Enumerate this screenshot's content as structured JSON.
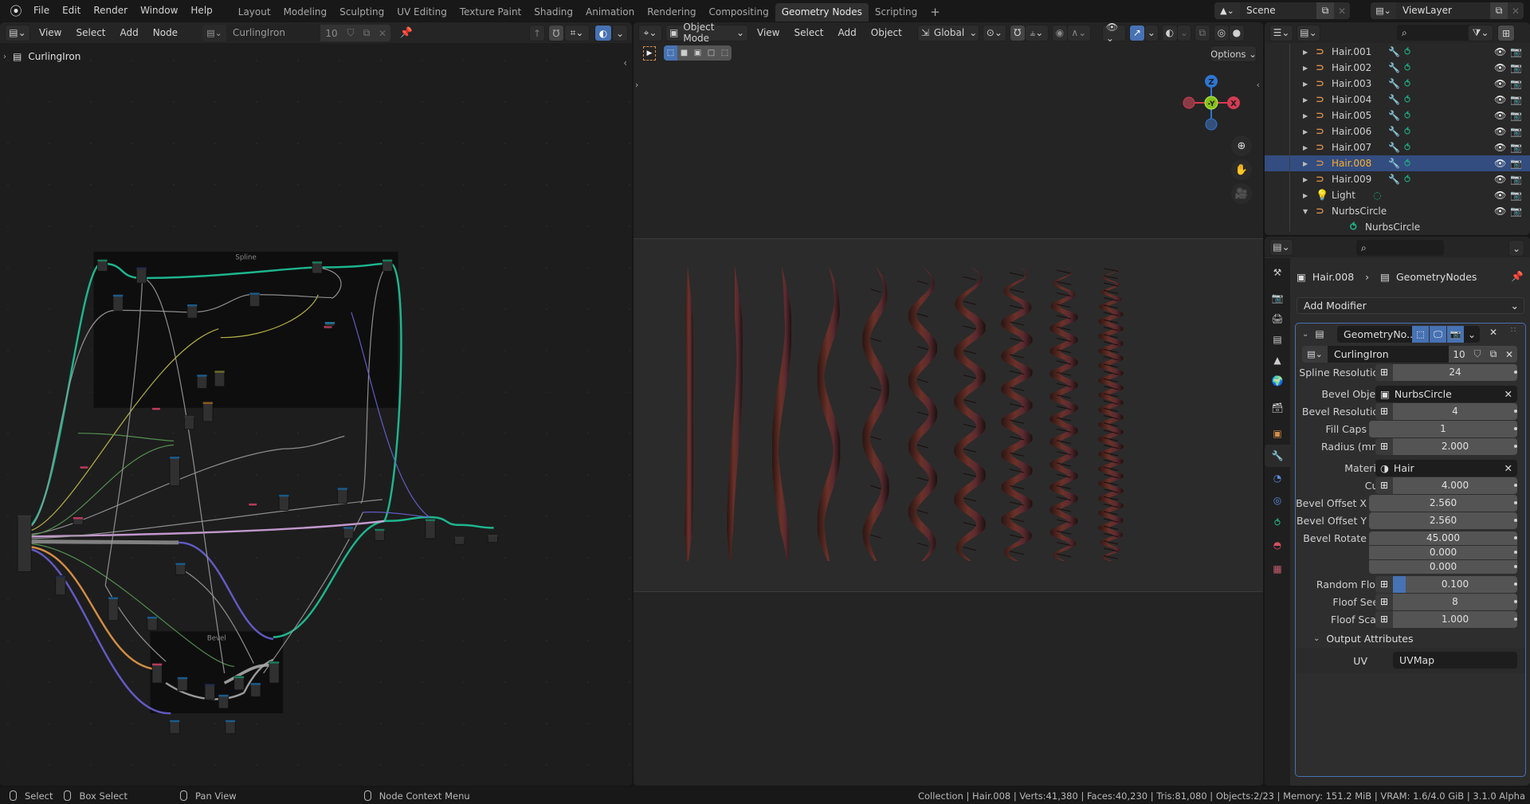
{
  "topbar": {
    "menus": [
      "File",
      "Edit",
      "Render",
      "Window",
      "Help"
    ],
    "workspaces": [
      "Layout",
      "Modeling",
      "Sculpting",
      "UV Editing",
      "Texture Paint",
      "Shading",
      "Animation",
      "Rendering",
      "Compositing",
      "Geometry Nodes",
      "Scripting"
    ],
    "active_workspace": "Geometry Nodes",
    "add_workspace": "+",
    "scene": "Scene",
    "view_layer": "ViewLayer"
  },
  "node_editor": {
    "menus": [
      "View",
      "Select",
      "Add",
      "Node"
    ],
    "node_group": "CurlingIron",
    "users": "10",
    "breadcrumb": "CurlingIron",
    "frames": [
      {
        "label": "Spline"
      },
      {
        "label": "Bevel"
      }
    ]
  },
  "viewport": {
    "mode": "Object Mode",
    "menus": [
      "View",
      "Select",
      "Add",
      "Object"
    ],
    "orientation": "Global",
    "options_label": "Options",
    "gizmo": {
      "z": "Z",
      "y": "-Y",
      "x": "X"
    },
    "strand_count": 10
  },
  "outliner": {
    "items": [
      {
        "name": "Hair.001",
        "type": "curve",
        "modifier": true,
        "data": true,
        "selected": false
      },
      {
        "name": "Hair.002",
        "type": "curve",
        "modifier": true,
        "data": true,
        "selected": false
      },
      {
        "name": "Hair.003",
        "type": "curve",
        "modifier": true,
        "data": true,
        "selected": false
      },
      {
        "name": "Hair.004",
        "type": "curve",
        "modifier": true,
        "data": true,
        "selected": false
      },
      {
        "name": "Hair.005",
        "type": "curve",
        "modifier": true,
        "data": true,
        "selected": false
      },
      {
        "name": "Hair.006",
        "type": "curve",
        "modifier": true,
        "data": true,
        "selected": false
      },
      {
        "name": "Hair.007",
        "type": "curve",
        "modifier": true,
        "data": true,
        "selected": false
      },
      {
        "name": "Hair.008",
        "type": "curve",
        "modifier": true,
        "data": true,
        "selected": true
      },
      {
        "name": "Hair.009",
        "type": "curve",
        "modifier": true,
        "data": true,
        "selected": false
      },
      {
        "name": "Light",
        "type": "light",
        "modifier": false,
        "data": true,
        "selected": false
      },
      {
        "name": "NurbsCircle",
        "type": "curve",
        "modifier": false,
        "data": false,
        "selected": false,
        "expanded": true
      },
      {
        "name": "NurbsCircle",
        "type": "curve-data",
        "child": true
      }
    ]
  },
  "properties": {
    "breadcrumb_object": "Hair.008",
    "breadcrumb_modifier": "GeometryNodes",
    "add_modifier": "Add Modifier",
    "modifier_name": "GeometryNo...",
    "node_group": "CurlingIron",
    "node_group_users": "10",
    "inputs": [
      {
        "label": "Spline Resolution",
        "value": "24",
        "type": "int",
        "node_toggle": true
      },
      {
        "label": "Bevel Object",
        "value": "NurbsCircle",
        "type": "object"
      },
      {
        "label": "Bevel Resolution",
        "value": "4",
        "type": "int",
        "node_toggle": true
      },
      {
        "label": "Fill Caps",
        "value": "1",
        "type": "int",
        "node_toggle": false
      },
      {
        "label": "Radius (mm)",
        "value": "2.000",
        "type": "float",
        "node_toggle": true
      },
      {
        "label": "Material",
        "value": "Hair",
        "type": "material"
      },
      {
        "label": "Curl",
        "value": "4.000",
        "type": "float",
        "node_toggle": true
      },
      {
        "label": "Bevel Offset X",
        "value": "2.560",
        "type": "float",
        "node_toggle": false
      },
      {
        "label": "Bevel Offset Y",
        "value": "2.560",
        "type": "float",
        "node_toggle": false
      },
      {
        "label": "Bevel Rotate",
        "value": "45.000",
        "type": "vector",
        "node_toggle": false
      },
      {
        "label": "",
        "value": "0.000",
        "type": "vector",
        "node_toggle": false
      },
      {
        "label": "",
        "value": "0.000",
        "type": "vector",
        "node_toggle": false
      },
      {
        "label": "Random Floof",
        "value": "0.100",
        "type": "factor",
        "node_toggle": true,
        "fraction": 0.1
      },
      {
        "label": "Floof Seed",
        "value": "8",
        "type": "int",
        "node_toggle": true
      },
      {
        "label": "Floof Scale",
        "value": "1.000",
        "type": "float",
        "node_toggle": true
      }
    ],
    "output_attributes_label": "Output Attributes",
    "uv_label": "UV",
    "uv_value": "UVMap"
  },
  "statusbar": {
    "hints": [
      "Select",
      "Box Select",
      "Pan View",
      "Node Context Menu"
    ],
    "info": "Collection | Hair.008 | Verts:41,380 | Faces:40,230 | Tris:81,080 | Objects:2/23 | Memory: 151.2 MiB | VRAM: 1.6/4.0 GiB | 3.1.0 Alpha"
  },
  "colors": {
    "accent": "#4772b3",
    "selected_text": "#ffaf29",
    "geometry_socket": "#00d6a3",
    "curve_icon": "#d38e4b",
    "modifier_icon": "#6a8fd8",
    "data_icon": "#1eb385"
  }
}
